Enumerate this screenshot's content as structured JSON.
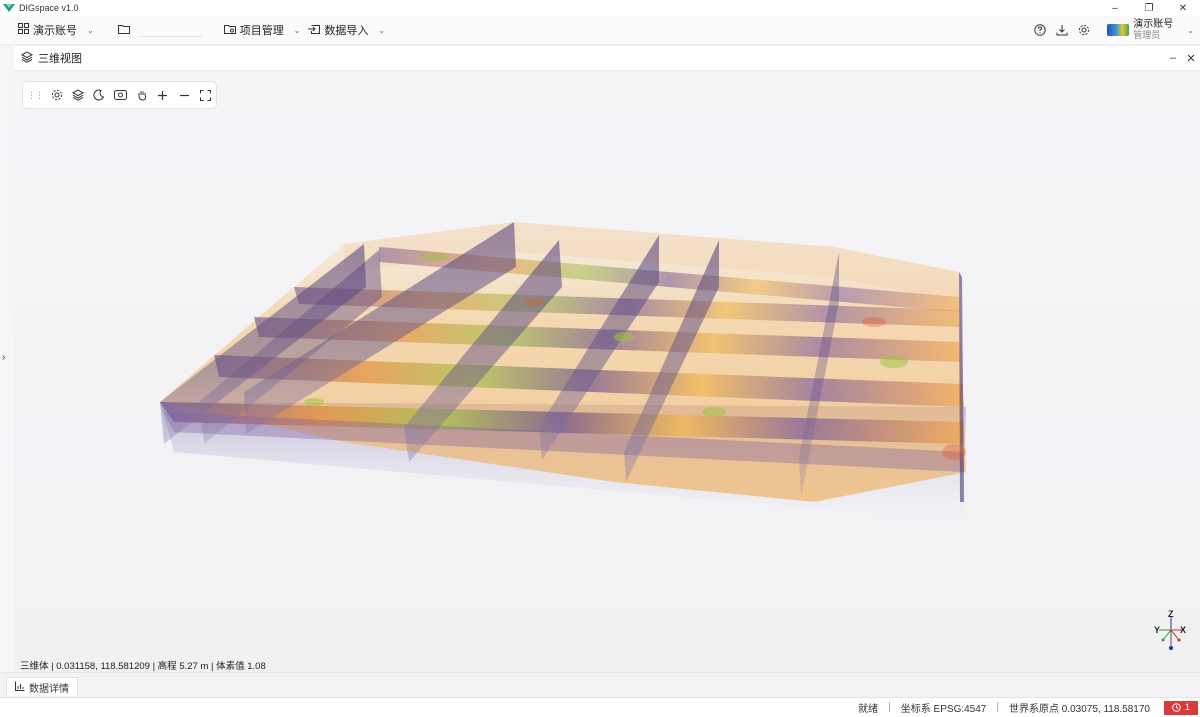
{
  "app": {
    "title": "DIGspace v1.0",
    "window_controls": [
      "–",
      "❐",
      "✕"
    ]
  },
  "menubar": {
    "account_label": "演示账号",
    "folder_value": "",
    "project_label": "项目管理",
    "import_label": "数据导入"
  },
  "user": {
    "name": "演示账号",
    "role": "管理员"
  },
  "panel": {
    "title": "三维视图",
    "minimize": "–",
    "close": "✕"
  },
  "toolbar": {
    "icons": [
      "settings-icon",
      "layers-icon",
      "moon-icon",
      "view-icon",
      "pan-icon",
      "zoom-in-icon",
      "zoom-out-icon",
      "fullscreen-icon"
    ]
  },
  "readout": {
    "text": "三维体 | 0.031158, 118.581209 | 高程 5.27 m | 体素值 1.08"
  },
  "axis": {
    "z": "Z",
    "y": "Y",
    "x": "X"
  },
  "bottom": {
    "tab_label": "数据详情"
  },
  "status": {
    "state": "就绪",
    "crs": "坐标系 EPSG:4547",
    "origin": "世界系原点  0.03075, 118.58170",
    "errors": "1"
  },
  "colors": {
    "accent_error": "#d93a3a",
    "volume_warm": "#f6b04a",
    "volume_cool": "#5a3c8c"
  }
}
